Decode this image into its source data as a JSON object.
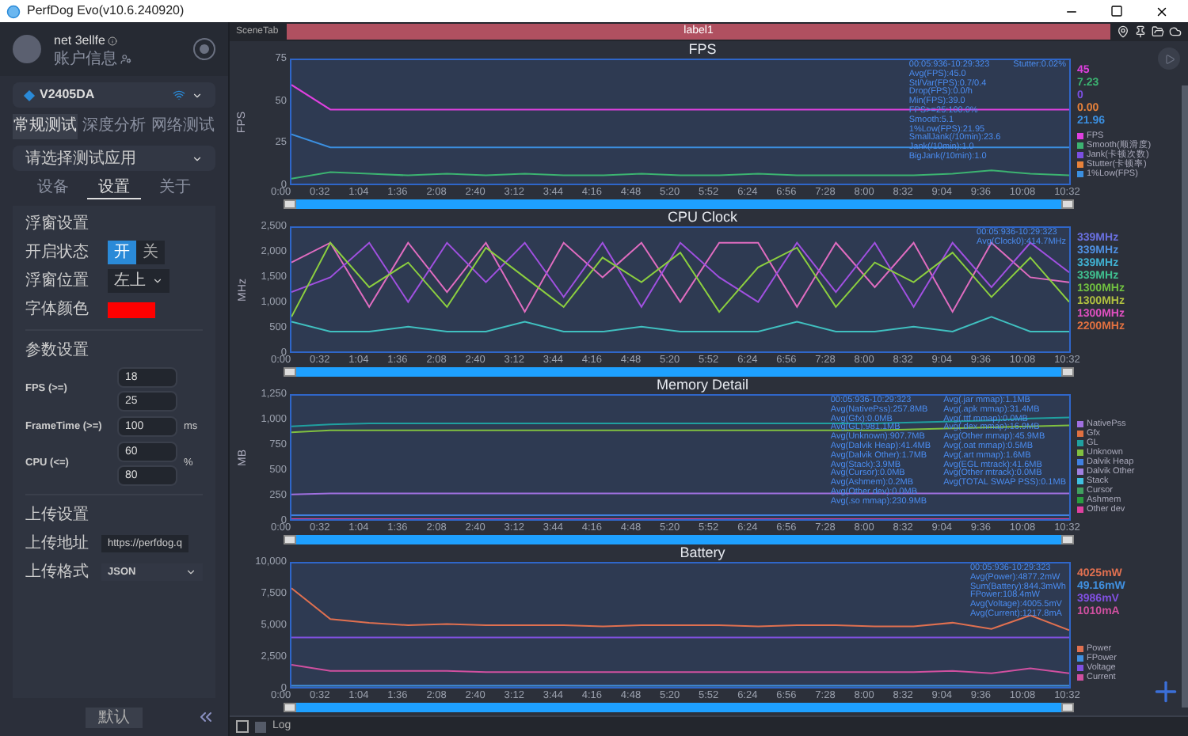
{
  "window": {
    "title": "PerfDog Evo(v10.6.240920)"
  },
  "account": {
    "name": "net 3ellfe",
    "info": "账户信息"
  },
  "device": {
    "name": "V2405DA"
  },
  "test_tabs": [
    {
      "label": "常规测试",
      "selected": true
    },
    {
      "label": "深度分析",
      "selected": false
    },
    {
      "label": "网络测试",
      "selected": false
    }
  ],
  "app_select": {
    "value": "请选择测试应用"
  },
  "panel_tabs": [
    {
      "label": "设备",
      "selected": false
    },
    {
      "label": "设置",
      "selected": true
    },
    {
      "label": "关于",
      "selected": false
    }
  ],
  "float_settings": {
    "title": "浮窗设置",
    "rows": [
      {
        "kind": "toggle",
        "label": "开启状态",
        "options": [
          {
            "label": "开",
            "selected": true
          },
          {
            "label": "关",
            "selected": false
          }
        ]
      },
      {
        "kind": "select",
        "label": "浮窗位置",
        "value": "左上"
      },
      {
        "kind": "color",
        "label": "字体颜色",
        "color": "#ff0000"
      }
    ]
  },
  "param_settings": {
    "title": "参数设置",
    "rows": [
      {
        "label": "FPS (>=)",
        "values": [
          "18",
          "25"
        ]
      },
      {
        "label": "FrameTime (>=)",
        "values": [
          "100"
        ],
        "unit": "ms"
      },
      {
        "label": "CPU (<=)",
        "values": [
          "60",
          "80"
        ],
        "unit": "%"
      }
    ]
  },
  "upload_settings": {
    "title": "上传设置",
    "rows": [
      {
        "kind": "input",
        "label": "上传地址",
        "value": "https://perfdog.q"
      },
      {
        "kind": "select",
        "label": "上传格式",
        "value": "JSON"
      }
    ]
  },
  "default_button": "默认",
  "scene_tab": "SceneTab",
  "label_bar": "label1",
  "charts": [
    {
      "title": "FPS",
      "stats": [
        [
          "00:05:936-10:29:323",
          "Avg(FPS):45.0",
          "Stl/Var(FPS):0.7/0.4",
          "Drop(FPS):0.0/h",
          "Min(FPS):39.0",
          "FPS>=25:100.0%",
          "Smooth:5.1",
          "1%Low(FPS):21.95",
          "SmallJank(/10min):23.6",
          "Jank(/10min):1.0",
          "BigJank(/10min):1.0"
        ],
        [
          "Stutter:0.02%"
        ]
      ],
      "readings": [
        {
          "text": "45",
          "color": "#e040e0"
        },
        {
          "text": "7.23",
          "color": "#3cb371"
        },
        {
          "text": "0",
          "color": "#7b4fe0"
        },
        {
          "text": "0.00",
          "color": "#e8823a"
        },
        {
          "text": "21.96",
          "color": "#3b8fe0"
        }
      ],
      "chart_data": {
        "type": "line",
        "legend": "right",
        "ylabel": "FPS",
        "categories": [
          "0:00",
          "0:32",
          "1:04",
          "1:36",
          "2:08",
          "2:40",
          "3:12",
          "3:44",
          "4:16",
          "4:48",
          "5:20",
          "5:52",
          "6:24",
          "6:56",
          "7:28",
          "8:00",
          "8:32",
          "9:04",
          "9:36",
          "10:08",
          "10:32"
        ],
        "yticks": [
          0,
          25,
          50,
          75
        ],
        "ylim": [
          0,
          75
        ],
        "series": [
          {
            "name": "FPS",
            "color": "#e040e0",
            "values": [
              60,
              45,
              45,
              45,
              45,
              45,
              45,
              45,
              45,
              45,
              45,
              45,
              45,
              45,
              45,
              45,
              45,
              45,
              45,
              45,
              45
            ]
          },
          {
            "name": "Smooth(顺滑度)",
            "color": "#3cb371",
            "values": [
              3,
              7,
              6,
              5,
              6,
              5,
              6,
              5,
              5,
              6,
              5,
              5,
              6,
              5,
              5,
              5,
              5,
              6,
              8,
              6,
              5
            ]
          },
          {
            "name": "Jank(卡顿次数)",
            "color": "#7b4fe0",
            "values": [
              null,
              null,
              null,
              null,
              null,
              null,
              null,
              null,
              null,
              null,
              null,
              null,
              null,
              null,
              null,
              null,
              null,
              null,
              null,
              null,
              null
            ]
          },
          {
            "name": "Stutter(卡顿率)",
            "color": "#e8823a",
            "values": [
              null,
              null,
              null,
              null,
              null,
              null,
              null,
              null,
              null,
              null,
              null,
              null,
              null,
              null,
              null,
              null,
              null,
              null,
              null,
              null,
              null
            ]
          },
          {
            "name": "1%Low(FPS)",
            "color": "#3b8fe0",
            "values": [
              30,
              22,
              22,
              22,
              22,
              22,
              22,
              22,
              22,
              22,
              22,
              22,
              22,
              22,
              22,
              22,
              22,
              22,
              22,
              22,
              22
            ]
          }
        ]
      }
    },
    {
      "title": "CPU Clock",
      "stats": [
        [
          "00:05:936-10:29:323",
          "Avg(Clock0):414.7MHz"
        ]
      ],
      "readings": [
        {
          "text": "339MHz",
          "color": "#6a70e0"
        },
        {
          "text": "339MHz",
          "color": "#4f8fe0"
        },
        {
          "text": "339MHz",
          "color": "#40b0d0"
        },
        {
          "text": "339MHz",
          "color": "#40c090"
        },
        {
          "text": "1300MHz",
          "color": "#70c040"
        },
        {
          "text": "1300MHz",
          "color": "#b0c040"
        },
        {
          "text": "1300MHz",
          "color": "#e050c0"
        },
        {
          "text": "2200MHz",
          "color": "#e07040"
        }
      ],
      "chart_data": {
        "type": "line",
        "ylabel": "MHz",
        "categories": [
          "0:00",
          "0:32",
          "1:04",
          "1:36",
          "2:08",
          "2:40",
          "3:12",
          "3:44",
          "4:16",
          "4:48",
          "5:20",
          "5:52",
          "6:24",
          "6:56",
          "7:28",
          "8:00",
          "8:32",
          "9:04",
          "9:36",
          "10:08",
          "10:32"
        ],
        "yticks": [
          0,
          500,
          {
            "value": 1000,
            "label": "1,000"
          },
          {
            "value": 1500,
            "label": "1,500"
          },
          {
            "value": 2000,
            "label": "2,000"
          },
          {
            "value": 2500,
            "label": "2,500"
          }
        ],
        "ylim": [
          0,
          2500
        ],
        "series": [
          {
            "color": "#e06cc0",
            "values": [
              1800,
              2200,
              900,
              2200,
              1200,
              2200,
              800,
              2200,
              1500,
              2200,
              1000,
              2200,
              2200,
              900,
              2200,
              1300,
              2200,
              800,
              2200,
              1500,
              1400
            ]
          },
          {
            "color": "#a050e0",
            "values": [
              1200,
              1500,
              2200,
              1000,
              2200,
              1400,
              2200,
              1100,
              2200,
              900,
              2200,
              1500,
              1000,
              2200,
              1200,
              2200,
              900,
              2200,
              1300,
              2200,
              1600
            ]
          },
          {
            "color": "#8ccf3f",
            "values": [
              700,
              2200,
              1300,
              1800,
              900,
              2100,
              1500,
              900,
              1900,
              1400,
              2000,
              800,
              1700,
              2100,
              900,
              1800,
              1400,
              2000,
              1100,
              1900,
              1000
            ]
          },
          {
            "color": "#40c0c0",
            "values": [
              600,
              400,
              400,
              500,
              400,
              400,
              600,
              400,
              400,
              500,
              400,
              400,
              400,
              600,
              400,
              400,
              500,
              400,
              700,
              400,
              400
            ]
          }
        ]
      }
    },
    {
      "title": "Memory Detail",
      "stats": [
        [
          "00:05:936-10:29:323",
          "Avg(NativePss):257.8MB",
          "Avg(Gfx):0.0MB",
          "Avg(GL):981.1MB",
          "Avg(Unknown):907.7MB",
          "Avg(Dalvik Heap):41.4MB",
          "Avg(Dalvik Other):1.7MB",
          "Avg(Stack):3.9MB",
          "Avg(Cursor):0.0MB",
          "Avg(Ashmem):0.2MB",
          "Avg(Other dev):0.0MB",
          "Avg(.so mmap):230.9MB"
        ],
        [
          "Avg(.jar mmap):1.1MB",
          "Avg(.apk mmap):31.4MB",
          "Avg(.ttf mmap):0.0MB",
          "Avg(.dex mmap):16.9MB",
          "Avg(Other mmap):45.9MB",
          "Avg(.oat mmap):0.5MB",
          "Avg(.art mmap):1.6MB",
          "Avg(EGL mtrack):41.6MB",
          "Avg(Other mtrack):0.0MB",
          "Avg(TOTAL SWAP PSS):0.1MB"
        ]
      ],
      "chart_data": {
        "type": "line",
        "legend": "right",
        "ylabel": "MB",
        "categories": [
          "0:00",
          "0:32",
          "1:04",
          "1:36",
          "2:08",
          "2:40",
          "3:12",
          "3:44",
          "4:16",
          "4:48",
          "5:20",
          "5:52",
          "6:24",
          "6:56",
          "7:28",
          "8:00",
          "8:32",
          "9:04",
          "9:36",
          "10:08",
          "10:32"
        ],
        "yticks": [
          0,
          250,
          500,
          750,
          {
            "value": 1000,
            "label": "1,000"
          },
          {
            "value": 1250,
            "label": "1,250"
          }
        ],
        "ylim": [
          0,
          1250
        ],
        "series": [
          {
            "name": "NativePss",
            "color": "#a070e0",
            "values": [
              250,
              260,
              260,
              260,
              260,
              260,
              260,
              260,
              260,
              260,
              260,
              260,
              260,
              260,
              260,
              260,
              260,
              260,
              260,
              260,
              260
            ]
          },
          {
            "name": "Gfx",
            "color": "#e07040",
            "values": [
              null,
              null,
              null,
              null,
              null,
              null,
              null,
              null,
              null,
              null,
              null,
              null,
              null,
              null,
              null,
              null,
              null,
              null,
              null,
              null,
              null
            ]
          },
          {
            "name": "GL",
            "color": "#20a0a0",
            "values": [
              940,
              960,
              970,
              970,
              970,
              970,
              970,
              970,
              970,
              970,
              970,
              970,
              970,
              970,
              970,
              970,
              980,
              990,
              1000,
              1020,
              1030
            ]
          },
          {
            "name": "Unknown",
            "color": "#80c040",
            "values": [
              880,
              900,
              900,
              900,
              900,
              900,
              900,
              900,
              900,
              900,
              900,
              900,
              900,
              900,
              900,
              900,
              910,
              920,
              930,
              940,
              950
            ]
          },
          {
            "name": "Dalvik Heap",
            "color": "#4080e0",
            "values": [
              40,
              40,
              40,
              40,
              40,
              40,
              40,
              40,
              40,
              40,
              40,
              40,
              40,
              40,
              40,
              40,
              40,
              40,
              40,
              40,
              40
            ]
          },
          {
            "name": "Dalvik Other",
            "color": "#a080e0",
            "values": [
              null,
              null,
              null,
              null,
              null,
              null,
              null,
              null,
              null,
              null,
              null,
              null,
              null,
              null,
              null,
              null,
              null,
              null,
              null,
              null,
              null
            ]
          },
          {
            "name": "Stack",
            "color": "#40c0e0",
            "values": [
              null,
              null,
              null,
              null,
              null,
              null,
              null,
              null,
              null,
              null,
              null,
              null,
              null,
              null,
              null,
              null,
              null,
              null,
              null,
              null,
              null
            ]
          },
          {
            "name": "Cursor",
            "color": "#40a060",
            "values": [
              null,
              null,
              null,
              null,
              null,
              null,
              null,
              null,
              null,
              null,
              null,
              null,
              null,
              null,
              null,
              null,
              null,
              null,
              null,
              null,
              null
            ]
          },
          {
            "name": "Ashmem",
            "color": "#2a9d40",
            "values": [
              null,
              null,
              null,
              null,
              null,
              null,
              null,
              null,
              null,
              null,
              null,
              null,
              null,
              null,
              null,
              null,
              null,
              null,
              null,
              null,
              null
            ]
          },
          {
            "name": "Other dev",
            "color": "#e040a0",
            "values": [
              0,
              0,
              0,
              0,
              0,
              0,
              0,
              0,
              0,
              0,
              0,
              0,
              0,
              0,
              0,
              0,
              0,
              0,
              0,
              0,
              0
            ]
          }
        ]
      }
    },
    {
      "title": "Battery",
      "stats": [
        [
          "00:05:936-10:29:323",
          "Avg(Power):4877.2mW",
          "Sum(Battery):844.3mWh",
          "FPower:108.4mW",
          "Avg(Voltage):4005.5mV",
          "Avg(Current):1217.8mA"
        ]
      ],
      "readings": [
        {
          "text": "4025mW",
          "color": "#e07050"
        },
        {
          "text": "49.16mW",
          "color": "#4090e0"
        },
        {
          "text": "3986mV",
          "color": "#8050e0"
        },
        {
          "text": "1010mA",
          "color": "#d050a0"
        }
      ],
      "chart_data": {
        "type": "line",
        "legend": "right",
        "categories": [
          "0:00",
          "0:32",
          "1:04",
          "1:36",
          "2:08",
          "2:40",
          "3:12",
          "3:44",
          "4:16",
          "4:48",
          "5:20",
          "5:52",
          "6:24",
          "6:56",
          "7:28",
          "8:00",
          "8:32",
          "9:04",
          "9:36",
          "10:08",
          "10:32"
        ],
        "yticks": [
          0,
          {
            "value": 2500,
            "label": "2,500"
          },
          {
            "value": 5000,
            "label": "5,000"
          },
          {
            "value": 7500,
            "label": "7,500"
          },
          {
            "value": 10000,
            "label": "10,000"
          }
        ],
        "ylim": [
          0,
          10000
        ],
        "series": [
          {
            "name": "Power",
            "color": "#e07050",
            "values": [
              8000,
              5500,
              5200,
              5000,
              5100,
              5000,
              5000,
              5000,
              4900,
              5000,
              5000,
              5000,
              4900,
              5000,
              5000,
              4900,
              4900,
              5200,
              4700,
              5800,
              4600
            ]
          },
          {
            "name": "FPower",
            "color": "#4090e0",
            "values": [
              100,
              100,
              100,
              100,
              100,
              100,
              100,
              100,
              100,
              100,
              100,
              100,
              100,
              100,
              100,
              100,
              100,
              100,
              100,
              100,
              100
            ]
          },
          {
            "name": "Voltage",
            "color": "#8050e0",
            "values": [
              4000,
              4000,
              4000,
              4000,
              4000,
              4000,
              4000,
              4000,
              4000,
              4000,
              4000,
              4000,
              4000,
              4000,
              4000,
              4000,
              4000,
              4000,
              4000,
              4000,
              4000
            ]
          },
          {
            "name": "Current",
            "color": "#d050a0",
            "values": [
              1800,
              1300,
              1300,
              1300,
              1300,
              1200,
              1200,
              1200,
              1200,
              1200,
              1200,
              1200,
              1200,
              1200,
              1200,
              1200,
              1200,
              1300,
              1100,
              1500,
              1100
            ]
          }
        ]
      }
    }
  ],
  "log": {
    "label": "Log",
    "checked": false
  }
}
